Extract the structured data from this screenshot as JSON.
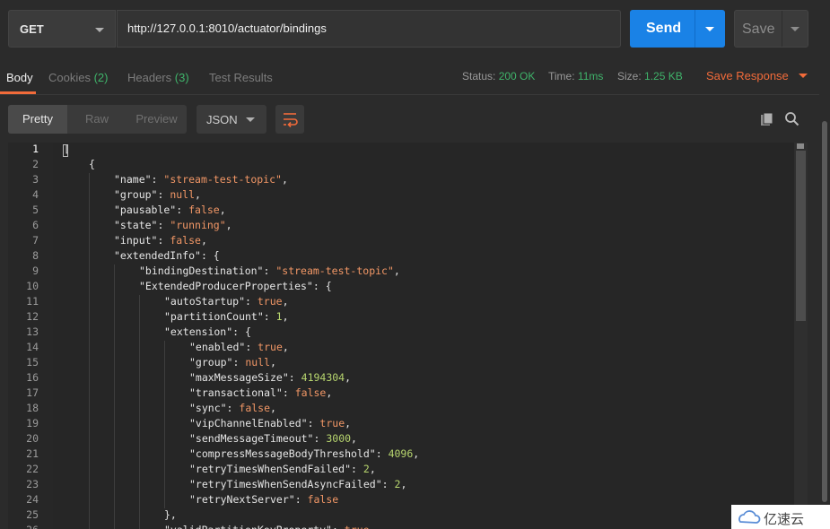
{
  "request": {
    "method": "GET",
    "url": "http://127.0.0.1:8010/actuator/bindings",
    "send_label": "Send",
    "save_label": "Save"
  },
  "response_tabs": [
    {
      "label": "Body",
      "count": ""
    },
    {
      "label": "Cookies",
      "count": "(2)"
    },
    {
      "label": "Headers",
      "count": "(3)"
    },
    {
      "label": "Test Results",
      "count": ""
    }
  ],
  "status": {
    "status_label": "Status:",
    "status_value": "200 OK",
    "time_label": "Time:",
    "time_value": "11ms",
    "size_label": "Size:",
    "size_value": "1.25 KB",
    "save_response": "Save Response"
  },
  "view": {
    "modes": [
      "Pretty",
      "Raw",
      "Preview"
    ],
    "format": "JSON"
  },
  "colors": {
    "accent": "#f26b3a",
    "send": "#1a82e6",
    "ok": "#3fb36a"
  },
  "code": {
    "start_line": 1,
    "lines": [
      {
        "indent": 0,
        "tokens": [
          [
            "p",
            "["
          ]
        ]
      },
      {
        "indent": 1,
        "tokens": [
          [
            "p",
            "{"
          ]
        ]
      },
      {
        "indent": 2,
        "tokens": [
          [
            "k",
            "\"name\""
          ],
          [
            "p",
            ": "
          ],
          [
            "s",
            "\"stream-test-topic\""
          ],
          [
            "p",
            ","
          ]
        ]
      },
      {
        "indent": 2,
        "tokens": [
          [
            "k",
            "\"group\""
          ],
          [
            "p",
            ": "
          ],
          [
            "b",
            "null"
          ],
          [
            "p",
            ","
          ]
        ]
      },
      {
        "indent": 2,
        "tokens": [
          [
            "k",
            "\"pausable\""
          ],
          [
            "p",
            ": "
          ],
          [
            "b",
            "false"
          ],
          [
            "p",
            ","
          ]
        ]
      },
      {
        "indent": 2,
        "tokens": [
          [
            "k",
            "\"state\""
          ],
          [
            "p",
            ": "
          ],
          [
            "s",
            "\"running\""
          ],
          [
            "p",
            ","
          ]
        ]
      },
      {
        "indent": 2,
        "tokens": [
          [
            "k",
            "\"input\""
          ],
          [
            "p",
            ": "
          ],
          [
            "b",
            "false"
          ],
          [
            "p",
            ","
          ]
        ]
      },
      {
        "indent": 2,
        "tokens": [
          [
            "k",
            "\"extendedInfo\""
          ],
          [
            "p",
            ": {"
          ]
        ]
      },
      {
        "indent": 3,
        "tokens": [
          [
            "k",
            "\"bindingDestination\""
          ],
          [
            "p",
            ": "
          ],
          [
            "s",
            "\"stream-test-topic\""
          ],
          [
            "p",
            ","
          ]
        ]
      },
      {
        "indent": 3,
        "tokens": [
          [
            "k",
            "\"ExtendedProducerProperties\""
          ],
          [
            "p",
            ": {"
          ]
        ]
      },
      {
        "indent": 4,
        "tokens": [
          [
            "k",
            "\"autoStartup\""
          ],
          [
            "p",
            ": "
          ],
          [
            "b",
            "true"
          ],
          [
            "p",
            ","
          ]
        ]
      },
      {
        "indent": 4,
        "tokens": [
          [
            "k",
            "\"partitionCount\""
          ],
          [
            "p",
            ": "
          ],
          [
            "n",
            "1"
          ],
          [
            "p",
            ","
          ]
        ]
      },
      {
        "indent": 4,
        "tokens": [
          [
            "k",
            "\"extension\""
          ],
          [
            "p",
            ": {"
          ]
        ]
      },
      {
        "indent": 5,
        "tokens": [
          [
            "k",
            "\"enabled\""
          ],
          [
            "p",
            ": "
          ],
          [
            "b",
            "true"
          ],
          [
            "p",
            ","
          ]
        ]
      },
      {
        "indent": 5,
        "tokens": [
          [
            "k",
            "\"group\""
          ],
          [
            "p",
            ": "
          ],
          [
            "b",
            "null"
          ],
          [
            "p",
            ","
          ]
        ]
      },
      {
        "indent": 5,
        "tokens": [
          [
            "k",
            "\"maxMessageSize\""
          ],
          [
            "p",
            ": "
          ],
          [
            "n",
            "4194304"
          ],
          [
            "p",
            ","
          ]
        ]
      },
      {
        "indent": 5,
        "tokens": [
          [
            "k",
            "\"transactional\""
          ],
          [
            "p",
            ": "
          ],
          [
            "b",
            "false"
          ],
          [
            "p",
            ","
          ]
        ]
      },
      {
        "indent": 5,
        "tokens": [
          [
            "k",
            "\"sync\""
          ],
          [
            "p",
            ": "
          ],
          [
            "b",
            "false"
          ],
          [
            "p",
            ","
          ]
        ]
      },
      {
        "indent": 5,
        "tokens": [
          [
            "k",
            "\"vipChannelEnabled\""
          ],
          [
            "p",
            ": "
          ],
          [
            "b",
            "true"
          ],
          [
            "p",
            ","
          ]
        ]
      },
      {
        "indent": 5,
        "tokens": [
          [
            "k",
            "\"sendMessageTimeout\""
          ],
          [
            "p",
            ": "
          ],
          [
            "n",
            "3000"
          ],
          [
            "p",
            ","
          ]
        ]
      },
      {
        "indent": 5,
        "tokens": [
          [
            "k",
            "\"compressMessageBodyThreshold\""
          ],
          [
            "p",
            ": "
          ],
          [
            "n",
            "4096"
          ],
          [
            "p",
            ","
          ]
        ]
      },
      {
        "indent": 5,
        "tokens": [
          [
            "k",
            "\"retryTimesWhenSendFailed\""
          ],
          [
            "p",
            ": "
          ],
          [
            "n",
            "2"
          ],
          [
            "p",
            ","
          ]
        ]
      },
      {
        "indent": 5,
        "tokens": [
          [
            "k",
            "\"retryTimesWhenSendAsyncFailed\""
          ],
          [
            "p",
            ": "
          ],
          [
            "n",
            "2"
          ],
          [
            "p",
            ","
          ]
        ]
      },
      {
        "indent": 5,
        "tokens": [
          [
            "k",
            "\"retryNextServer\""
          ],
          [
            "p",
            ": "
          ],
          [
            "b",
            "false"
          ]
        ]
      },
      {
        "indent": 4,
        "tokens": [
          [
            "p",
            "},"
          ]
        ]
      },
      {
        "indent": 4,
        "tokens": [
          [
            "k",
            "\"validPartitionKeyProperty\""
          ],
          [
            "p",
            ": "
          ],
          [
            "b",
            "true"
          ]
        ]
      }
    ]
  },
  "watermark": "亿速云"
}
